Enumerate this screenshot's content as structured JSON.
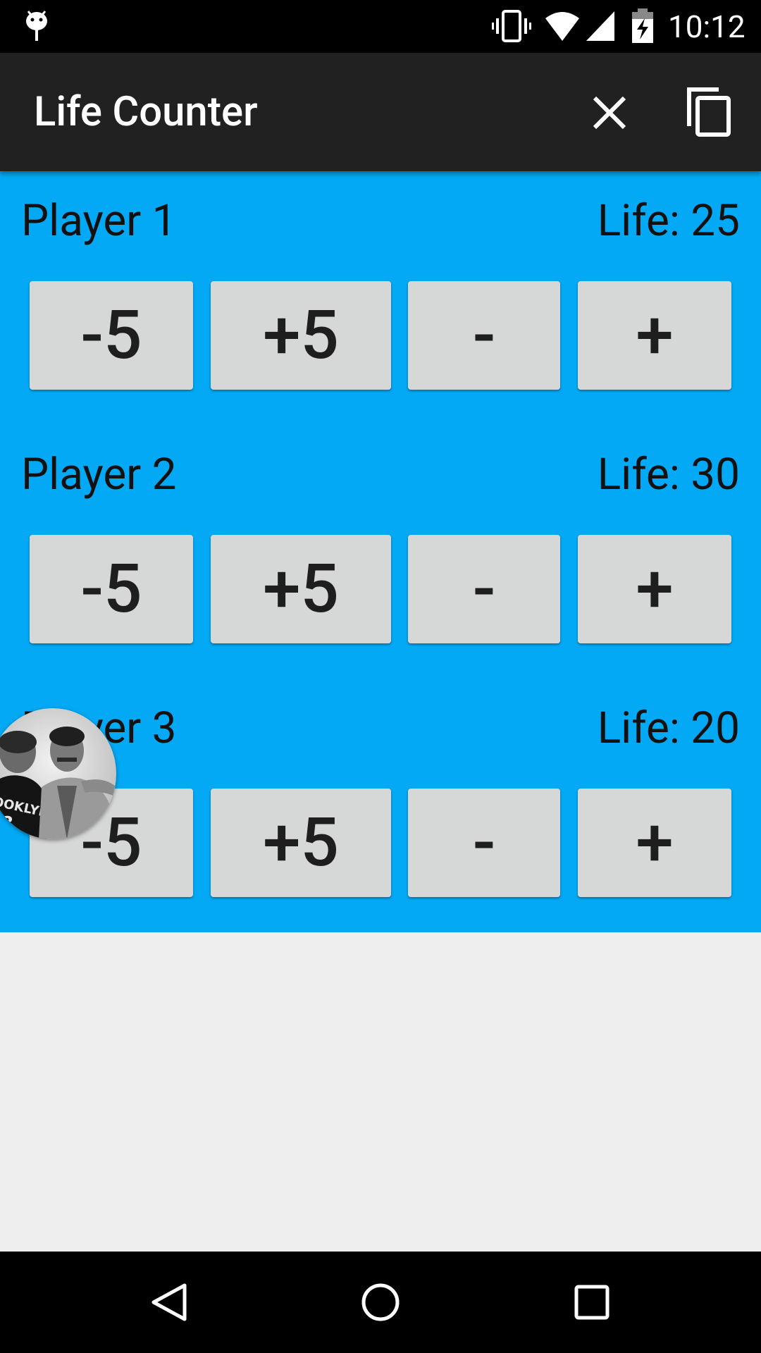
{
  "status_bar": {
    "time": "10:12",
    "icons": [
      "android-icon",
      "vibrate-icon",
      "wifi-icon",
      "signal-icon",
      "battery-charging-icon"
    ]
  },
  "app_bar": {
    "title": "Life Counter",
    "actions": [
      "close-icon",
      "copy-icon"
    ]
  },
  "players": [
    {
      "name": "Player 1",
      "life_text": "Life: 25",
      "buttons": [
        "-5",
        "+5",
        "-",
        "+"
      ]
    },
    {
      "name": "Player 2",
      "life_text": "Life: 30",
      "buttons": [
        "-5",
        "+5",
        "-",
        "+"
      ]
    },
    {
      "name": "Player 3",
      "life_text": "Life: 20",
      "buttons": [
        "-5",
        "+5",
        "-",
        "+"
      ]
    }
  ],
  "nav_bar": {
    "icons": [
      "back-icon",
      "home-icon",
      "recents-icon"
    ]
  },
  "colors": {
    "status_bar": "#000000",
    "app_bar": "#212121",
    "content_bg": "#03a9f4",
    "button_bg": "#d6d7d7",
    "page_bg": "#eeeeee"
  }
}
